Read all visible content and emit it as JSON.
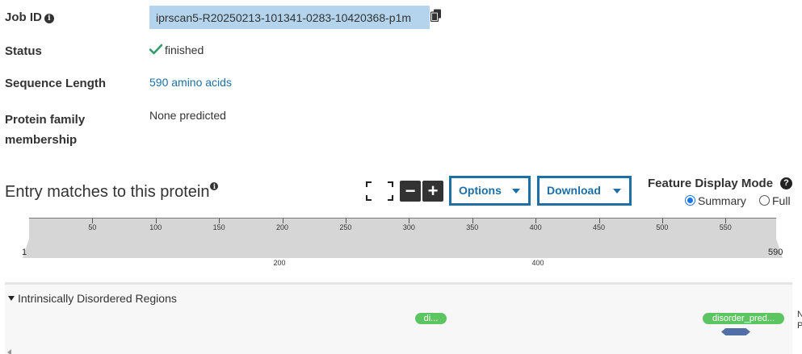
{
  "summary": {
    "job_id_label": "Job ID",
    "job_id_value": "iprscan5-R20250213-101341-0283-10420368-p1m",
    "status_label": "Status",
    "status_value": "finished",
    "seq_length_label": "Sequence Length",
    "seq_length_value": "590 amino acids",
    "family_label_line1": "Protein family",
    "family_label_line2": "membership",
    "family_value": "None predicted"
  },
  "entry": {
    "title": "Entry matches to this protein",
    "zoom_out": "−",
    "zoom_in": "+",
    "options_label": "Options",
    "download_label": "Download",
    "display_mode_title": "Feature Display Mode",
    "mode_summary": "Summary",
    "mode_full": "Full",
    "mode_selected": "Summary"
  },
  "ruler": {
    "length": 590,
    "ticks": [
      "50",
      "100",
      "150",
      "200",
      "250",
      "300",
      "350",
      "400",
      "450",
      "500",
      "550"
    ],
    "start_label": "1",
    "end_label": "590",
    "axis_labels": [
      "200",
      "400"
    ]
  },
  "tracks": {
    "disordered_title": "Intrinsically Disordered Regions",
    "feature1_label": "di...",
    "feature2_label": "disorder_pred...",
    "cut_text_1": "N",
    "cut_text_2": "P"
  },
  "colors": {
    "accent_blue": "#1d6fa5",
    "job_highlight": "#b3d4ec",
    "check_green": "#2e9e6b",
    "feature_green": "#5cc561",
    "feature_blue": "#4f6fa6",
    "ruler_grey": "#d6d6d6"
  }
}
